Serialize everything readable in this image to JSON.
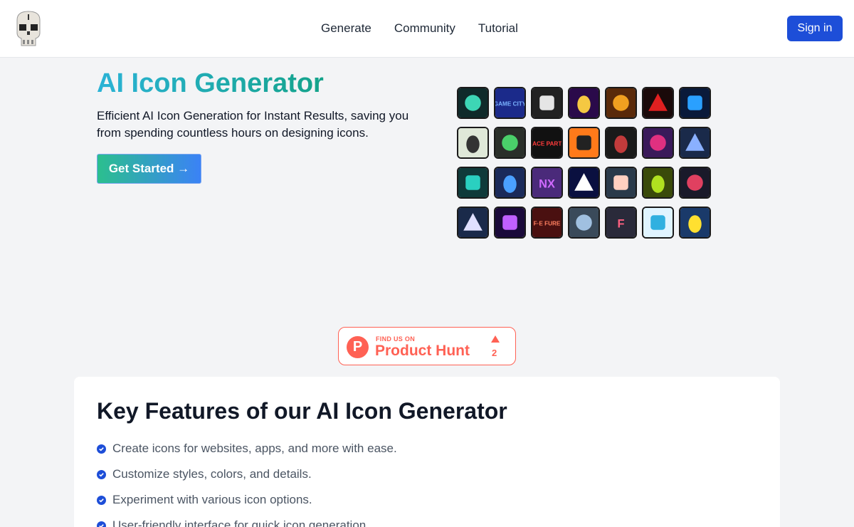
{
  "header": {
    "nav": [
      "Generate",
      "Community",
      "Tutorial"
    ],
    "signin_label": "Sign in"
  },
  "hero": {
    "title": "AI Icon Generator",
    "description": "Efficient AI Icon Generation for Instant Results, saving you from spending countless hours on designing icons.",
    "cta_label": "Get Started →"
  },
  "icons": [
    {
      "name": "triangle-logo",
      "bg": "#0f2a2a",
      "fg": "#3dd6b5"
    },
    {
      "name": "game-city",
      "bg": "#1b2a8a",
      "fg": "#7ab3ff",
      "text": "GAME CITY"
    },
    {
      "name": "robot-grid",
      "bg": "#222",
      "fg": "#e5e5e5"
    },
    {
      "name": "deer",
      "bg": "#2a0a4a",
      "fg": "#f5c842"
    },
    {
      "name": "book",
      "bg": "#5a2a0a",
      "fg": "#f0a020"
    },
    {
      "name": "cards",
      "bg": "#1a0a0a",
      "fg": "#e02020"
    },
    {
      "name": "eye",
      "bg": "#0a1a3a",
      "fg": "#2aa0ff"
    },
    {
      "name": "gun",
      "bg": "#dfe8d8",
      "fg": "#333"
    },
    {
      "name": "car",
      "bg": "#2a2f2a",
      "fg": "#4ad06a"
    },
    {
      "name": "race-party",
      "bg": "#111",
      "fg": "#ff3b3b",
      "text": "RACE PARTY"
    },
    {
      "name": "sunset",
      "bg": "#ff7a1a",
      "fg": "#222"
    },
    {
      "name": "head",
      "bg": "#1a1a1a",
      "fg": "#c23b3b"
    },
    {
      "name": "rocket",
      "bg": "#3a1a5a",
      "fg": "#e03080"
    },
    {
      "name": "figure",
      "bg": "#1a2a4a",
      "fg": "#8ab0ff"
    },
    {
      "name": "robot-teal",
      "bg": "#0f3a3a",
      "fg": "#2ad0c0"
    },
    {
      "name": "chart-circle",
      "bg": "#1a2a5a",
      "fg": "#4aa0ff"
    },
    {
      "name": "nx",
      "bg": "#4a2a7a",
      "fg": "#d06aff",
      "text": "NX"
    },
    {
      "name": "moon-chart",
      "bg": "#0a1040",
      "fg": "#ffffff"
    },
    {
      "name": "baby",
      "bg": "#2a3a4a",
      "fg": "#ffd0c0"
    },
    {
      "name": "alien",
      "bg": "#3a4a0a",
      "fg": "#b0e020"
    },
    {
      "name": "gamepad",
      "bg": "#1a1a2a",
      "fg": "#e04060"
    },
    {
      "name": "wizard",
      "bg": "#1a2a4a",
      "fg": "#e0e0ff"
    },
    {
      "name": "flower",
      "bg": "#1a0a3a",
      "fg": "#c060ff"
    },
    {
      "name": "fire-fure",
      "bg": "#4a1010",
      "fg": "#ff8060",
      "text": "F·E FURE"
    },
    {
      "name": "skull-blue",
      "bg": "#3a4a5a",
      "fg": "#a0c0e0"
    },
    {
      "name": "letter-f",
      "bg": "#2a2a3a",
      "fg": "#ff6080",
      "text": "F"
    },
    {
      "name": "smiley",
      "bg": "#e0f4ff",
      "fg": "#30b0e0"
    },
    {
      "name": "sponge",
      "bg": "#1a3a6a",
      "fg": "#ffe030"
    }
  ],
  "product_hunt": {
    "small": "FIND US ON",
    "big": "Product Hunt",
    "count": "2",
    "letter": "P"
  },
  "features": {
    "title": "Key Features of our AI Icon Generator",
    "items": [
      "Create icons for websites, apps, and more with ease.",
      "Customize styles, colors, and details.",
      "Experiment with various icon options.",
      "User-friendly interface for quick icon generation."
    ]
  }
}
